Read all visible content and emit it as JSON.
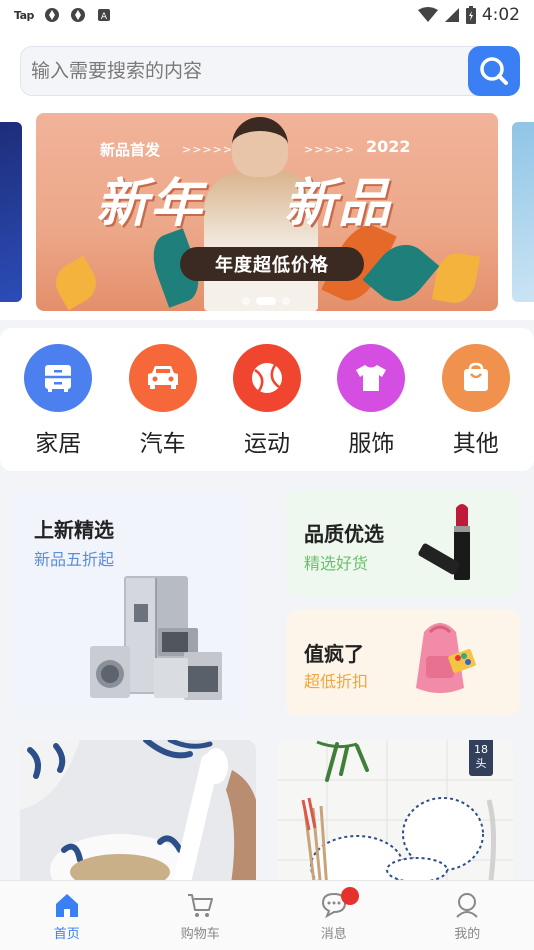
{
  "status_bar": {
    "tap_label": "Tap",
    "time": "4:02",
    "icons": [
      "tap-icon",
      "sync-icon",
      "sync-icon",
      "a-icon",
      "wifi-icon",
      "signal-icon",
      "battery-icon"
    ]
  },
  "search": {
    "placeholder": "输入需要搜索的内容",
    "button_icon": "search-icon",
    "accent": "#3b7ff5"
  },
  "banner": {
    "tag_left": "新品首发",
    "arrows": ">>>>>",
    "year": "2022",
    "headline_left": "新年",
    "headline_right": "新品",
    "pill_text": "年度超低价格",
    "slide_count": 3,
    "active_slide": 2
  },
  "categories": [
    {
      "label": "家居",
      "icon": "cabinet-icon",
      "color": "#4d80ef"
    },
    {
      "label": "汽车",
      "icon": "car-icon",
      "color": "#f6683a"
    },
    {
      "label": "运动",
      "icon": "ball-icon",
      "color": "#f0452e"
    },
    {
      "label": "服饰",
      "icon": "tshirt-icon",
      "color": "#d54ee2"
    },
    {
      "label": "其他",
      "icon": "bag-icon",
      "color": "#f0914e"
    }
  ],
  "features": {
    "left": {
      "title": "上新精选",
      "subtitle": "新品五折起"
    },
    "right_top": {
      "title": "品质优选",
      "subtitle": "精选好货"
    },
    "right_bottom": {
      "title": "值疯了",
      "subtitle": "超低折扣"
    }
  },
  "products": [
    {
      "image": "bowl-with-spoon"
    },
    {
      "image": "plates-and-chopsticks",
      "badge": "18头"
    }
  ],
  "tabbar": [
    {
      "label": "首页",
      "icon": "home-icon",
      "active": true
    },
    {
      "label": "购物车",
      "icon": "cart-icon",
      "active": false
    },
    {
      "label": "消息",
      "icon": "message-icon",
      "active": false,
      "notification": true
    },
    {
      "label": "我的",
      "icon": "user-icon",
      "active": false
    }
  ]
}
